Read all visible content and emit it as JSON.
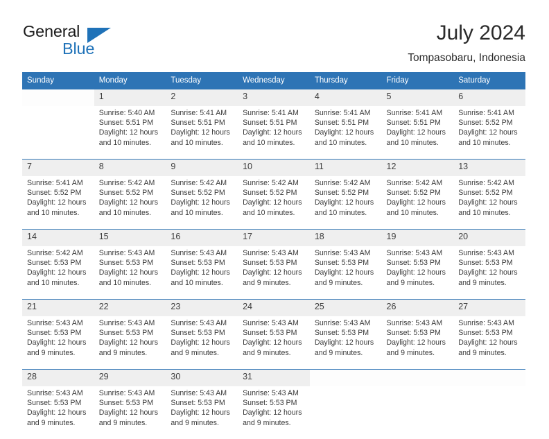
{
  "brand": {
    "name_part1": "General",
    "name_part2": "Blue",
    "triangle_color": "#1f72b8"
  },
  "header": {
    "title": "July 2024",
    "subtitle": "Tompasobaru, Indonesia"
  },
  "colors": {
    "header_blue": "#2e74b5",
    "daynum_band": "#efefef",
    "text": "#3a3a3a"
  },
  "calendar": {
    "weekday_headers": [
      "Sunday",
      "Monday",
      "Tuesday",
      "Wednesday",
      "Thursday",
      "Friday",
      "Saturday"
    ],
    "weeks": [
      {
        "days": [
          {
            "num": "",
            "lines": []
          },
          {
            "num": "1",
            "lines": [
              "Sunrise: 5:40 AM",
              "Sunset: 5:51 PM",
              "Daylight: 12 hours",
              "and 10 minutes."
            ]
          },
          {
            "num": "2",
            "lines": [
              "Sunrise: 5:41 AM",
              "Sunset: 5:51 PM",
              "Daylight: 12 hours",
              "and 10 minutes."
            ]
          },
          {
            "num": "3",
            "lines": [
              "Sunrise: 5:41 AM",
              "Sunset: 5:51 PM",
              "Daylight: 12 hours",
              "and 10 minutes."
            ]
          },
          {
            "num": "4",
            "lines": [
              "Sunrise: 5:41 AM",
              "Sunset: 5:51 PM",
              "Daylight: 12 hours",
              "and 10 minutes."
            ]
          },
          {
            "num": "5",
            "lines": [
              "Sunrise: 5:41 AM",
              "Sunset: 5:51 PM",
              "Daylight: 12 hours",
              "and 10 minutes."
            ]
          },
          {
            "num": "6",
            "lines": [
              "Sunrise: 5:41 AM",
              "Sunset: 5:52 PM",
              "Daylight: 12 hours",
              "and 10 minutes."
            ]
          }
        ]
      },
      {
        "days": [
          {
            "num": "7",
            "lines": [
              "Sunrise: 5:41 AM",
              "Sunset: 5:52 PM",
              "Daylight: 12 hours",
              "and 10 minutes."
            ]
          },
          {
            "num": "8",
            "lines": [
              "Sunrise: 5:42 AM",
              "Sunset: 5:52 PM",
              "Daylight: 12 hours",
              "and 10 minutes."
            ]
          },
          {
            "num": "9",
            "lines": [
              "Sunrise: 5:42 AM",
              "Sunset: 5:52 PM",
              "Daylight: 12 hours",
              "and 10 minutes."
            ]
          },
          {
            "num": "10",
            "lines": [
              "Sunrise: 5:42 AM",
              "Sunset: 5:52 PM",
              "Daylight: 12 hours",
              "and 10 minutes."
            ]
          },
          {
            "num": "11",
            "lines": [
              "Sunrise: 5:42 AM",
              "Sunset: 5:52 PM",
              "Daylight: 12 hours",
              "and 10 minutes."
            ]
          },
          {
            "num": "12",
            "lines": [
              "Sunrise: 5:42 AM",
              "Sunset: 5:52 PM",
              "Daylight: 12 hours",
              "and 10 minutes."
            ]
          },
          {
            "num": "13",
            "lines": [
              "Sunrise: 5:42 AM",
              "Sunset: 5:52 PM",
              "Daylight: 12 hours",
              "and 10 minutes."
            ]
          }
        ]
      },
      {
        "days": [
          {
            "num": "14",
            "lines": [
              "Sunrise: 5:42 AM",
              "Sunset: 5:53 PM",
              "Daylight: 12 hours",
              "and 10 minutes."
            ]
          },
          {
            "num": "15",
            "lines": [
              "Sunrise: 5:43 AM",
              "Sunset: 5:53 PM",
              "Daylight: 12 hours",
              "and 10 minutes."
            ]
          },
          {
            "num": "16",
            "lines": [
              "Sunrise: 5:43 AM",
              "Sunset: 5:53 PM",
              "Daylight: 12 hours",
              "and 10 minutes."
            ]
          },
          {
            "num": "17",
            "lines": [
              "Sunrise: 5:43 AM",
              "Sunset: 5:53 PM",
              "Daylight: 12 hours",
              "and 9 minutes."
            ]
          },
          {
            "num": "18",
            "lines": [
              "Sunrise: 5:43 AM",
              "Sunset: 5:53 PM",
              "Daylight: 12 hours",
              "and 9 minutes."
            ]
          },
          {
            "num": "19",
            "lines": [
              "Sunrise: 5:43 AM",
              "Sunset: 5:53 PM",
              "Daylight: 12 hours",
              "and 9 minutes."
            ]
          },
          {
            "num": "20",
            "lines": [
              "Sunrise: 5:43 AM",
              "Sunset: 5:53 PM",
              "Daylight: 12 hours",
              "and 9 minutes."
            ]
          }
        ]
      },
      {
        "days": [
          {
            "num": "21",
            "lines": [
              "Sunrise: 5:43 AM",
              "Sunset: 5:53 PM",
              "Daylight: 12 hours",
              "and 9 minutes."
            ]
          },
          {
            "num": "22",
            "lines": [
              "Sunrise: 5:43 AM",
              "Sunset: 5:53 PM",
              "Daylight: 12 hours",
              "and 9 minutes."
            ]
          },
          {
            "num": "23",
            "lines": [
              "Sunrise: 5:43 AM",
              "Sunset: 5:53 PM",
              "Daylight: 12 hours",
              "and 9 minutes."
            ]
          },
          {
            "num": "24",
            "lines": [
              "Sunrise: 5:43 AM",
              "Sunset: 5:53 PM",
              "Daylight: 12 hours",
              "and 9 minutes."
            ]
          },
          {
            "num": "25",
            "lines": [
              "Sunrise: 5:43 AM",
              "Sunset: 5:53 PM",
              "Daylight: 12 hours",
              "and 9 minutes."
            ]
          },
          {
            "num": "26",
            "lines": [
              "Sunrise: 5:43 AM",
              "Sunset: 5:53 PM",
              "Daylight: 12 hours",
              "and 9 minutes."
            ]
          },
          {
            "num": "27",
            "lines": [
              "Sunrise: 5:43 AM",
              "Sunset: 5:53 PM",
              "Daylight: 12 hours",
              "and 9 minutes."
            ]
          }
        ]
      },
      {
        "days": [
          {
            "num": "28",
            "lines": [
              "Sunrise: 5:43 AM",
              "Sunset: 5:53 PM",
              "Daylight: 12 hours",
              "and 9 minutes."
            ]
          },
          {
            "num": "29",
            "lines": [
              "Sunrise: 5:43 AM",
              "Sunset: 5:53 PM",
              "Daylight: 12 hours",
              "and 9 minutes."
            ]
          },
          {
            "num": "30",
            "lines": [
              "Sunrise: 5:43 AM",
              "Sunset: 5:53 PM",
              "Daylight: 12 hours",
              "and 9 minutes."
            ]
          },
          {
            "num": "31",
            "lines": [
              "Sunrise: 5:43 AM",
              "Sunset: 5:53 PM",
              "Daylight: 12 hours",
              "and 9 minutes."
            ]
          },
          {
            "num": "",
            "lines": []
          },
          {
            "num": "",
            "lines": []
          },
          {
            "num": "",
            "lines": []
          }
        ]
      }
    ]
  }
}
